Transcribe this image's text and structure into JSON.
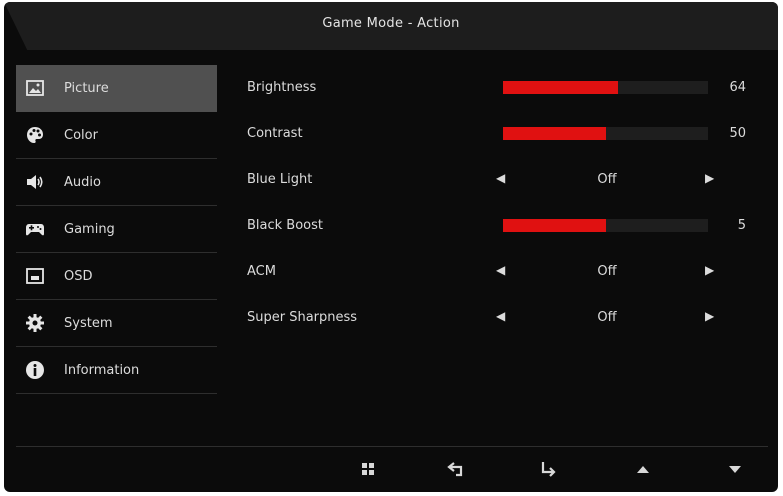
{
  "osd": {
    "title": "Game Mode - Action"
  },
  "sidebar": {
    "items": [
      {
        "label": "Picture",
        "icon": "picture-icon",
        "active": true
      },
      {
        "label": "Color",
        "icon": "palette-icon",
        "active": false
      },
      {
        "label": "Audio",
        "icon": "speaker-icon",
        "active": false
      },
      {
        "label": "Gaming",
        "icon": "gamepad-icon",
        "active": false
      },
      {
        "label": "OSD",
        "icon": "osd-window-icon",
        "active": false
      },
      {
        "label": "System",
        "icon": "gear-icon",
        "active": false
      },
      {
        "label": "Information",
        "icon": "info-icon",
        "active": false
      }
    ]
  },
  "settings": {
    "brightness": {
      "label": "Brightness",
      "value": "64",
      "level": 0.56
    },
    "contrast": {
      "label": "Contrast",
      "value": "50",
      "level": 0.5
    },
    "blue_light": {
      "label": "Blue Light",
      "value": "Off"
    },
    "black_boost": {
      "label": "Black Boost",
      "value": "5",
      "level": 0.5
    },
    "acm": {
      "label": "ACM",
      "value": "Off"
    },
    "super_sharpness": {
      "label": "Super Sharpness",
      "value": "Off"
    }
  },
  "footer": {
    "buttons": [
      "menu-grid-icon",
      "back-icon",
      "enter-icon",
      "up-arrow-icon",
      "down-arrow-icon"
    ]
  },
  "colors": {
    "accent": "#e01111",
    "active_item": "#505050",
    "background": "#0b0b0b",
    "text": "#dcdcdc"
  }
}
